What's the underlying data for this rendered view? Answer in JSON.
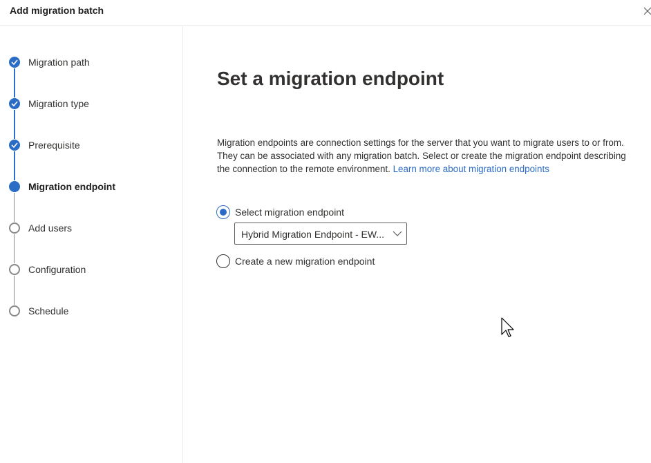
{
  "header": {
    "title": "Add migration batch",
    "close_icon": "close-icon"
  },
  "steps": [
    {
      "label": "Migration path",
      "state": "done"
    },
    {
      "label": "Migration type",
      "state": "done"
    },
    {
      "label": "Prerequisite",
      "state": "done"
    },
    {
      "label": "Migration endpoint",
      "state": "current"
    },
    {
      "label": "Add users",
      "state": "todo"
    },
    {
      "label": "Configuration",
      "state": "todo"
    },
    {
      "label": "Schedule",
      "state": "todo"
    }
  ],
  "main": {
    "title": "Set a migration endpoint",
    "description": "Migration endpoints are connection settings for the server that you want to migrate users to or from. They can be associated with any migration batch. Select or create the migration endpoint describing the connection to the remote environment.",
    "learn_more_link": "Learn more about migration endpoints",
    "options": {
      "select_label": "Select migration endpoint",
      "select_checked": true,
      "create_label": "Create a new migration endpoint",
      "create_checked": false
    },
    "endpoint_dropdown": {
      "value": "Hybrid Migration Endpoint - EW..."
    }
  },
  "colors": {
    "accent": "#2b6cc7",
    "text": "#323130",
    "border": "#edebe9"
  }
}
